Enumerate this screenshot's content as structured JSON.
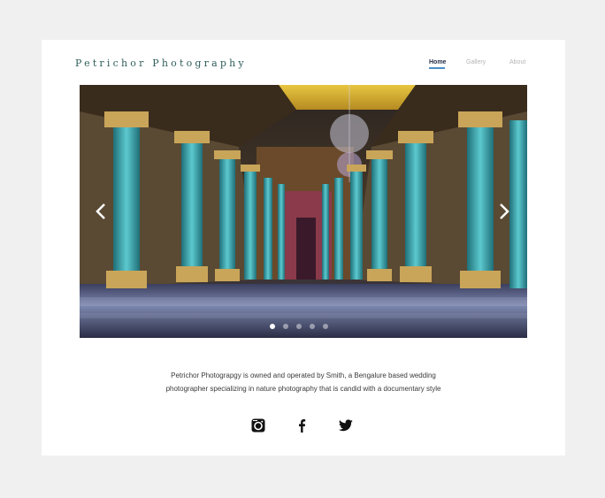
{
  "header": {
    "brand": "Petrichor Photography",
    "nav": [
      {
        "label": "Home",
        "active": true
      },
      {
        "label": "Gallery",
        "active": false
      },
      {
        "label": "About",
        "active": false
      }
    ]
  },
  "slider": {
    "slide_count": 5,
    "active_slide": 1,
    "prev_icon": "chevron-left-icon",
    "next_icon": "chevron-right-icon"
  },
  "intro": {
    "line1": "Petrichor Photograpgy is owned and operated by Smith, a Bengalure based wedding",
    "line2": "photographer specializing in nature photography that is candid with a documentary style"
  },
  "social": [
    {
      "name": "instagram",
      "icon": "instagram-icon"
    },
    {
      "name": "facebook",
      "icon": "facebook-icon"
    },
    {
      "name": "twitter",
      "icon": "twitter-icon"
    }
  ],
  "colors": {
    "background": "#f0f0f0",
    "card": "#ffffff",
    "brand": "#2f5e5a",
    "nav_active": "#1f2a44",
    "nav_underline": "#4a8ec9",
    "nav_inactive": "#b5b5b5",
    "column_teal": "#3aa7ad",
    "gold": "#c9a55a",
    "floor": "#6f7fa8"
  }
}
